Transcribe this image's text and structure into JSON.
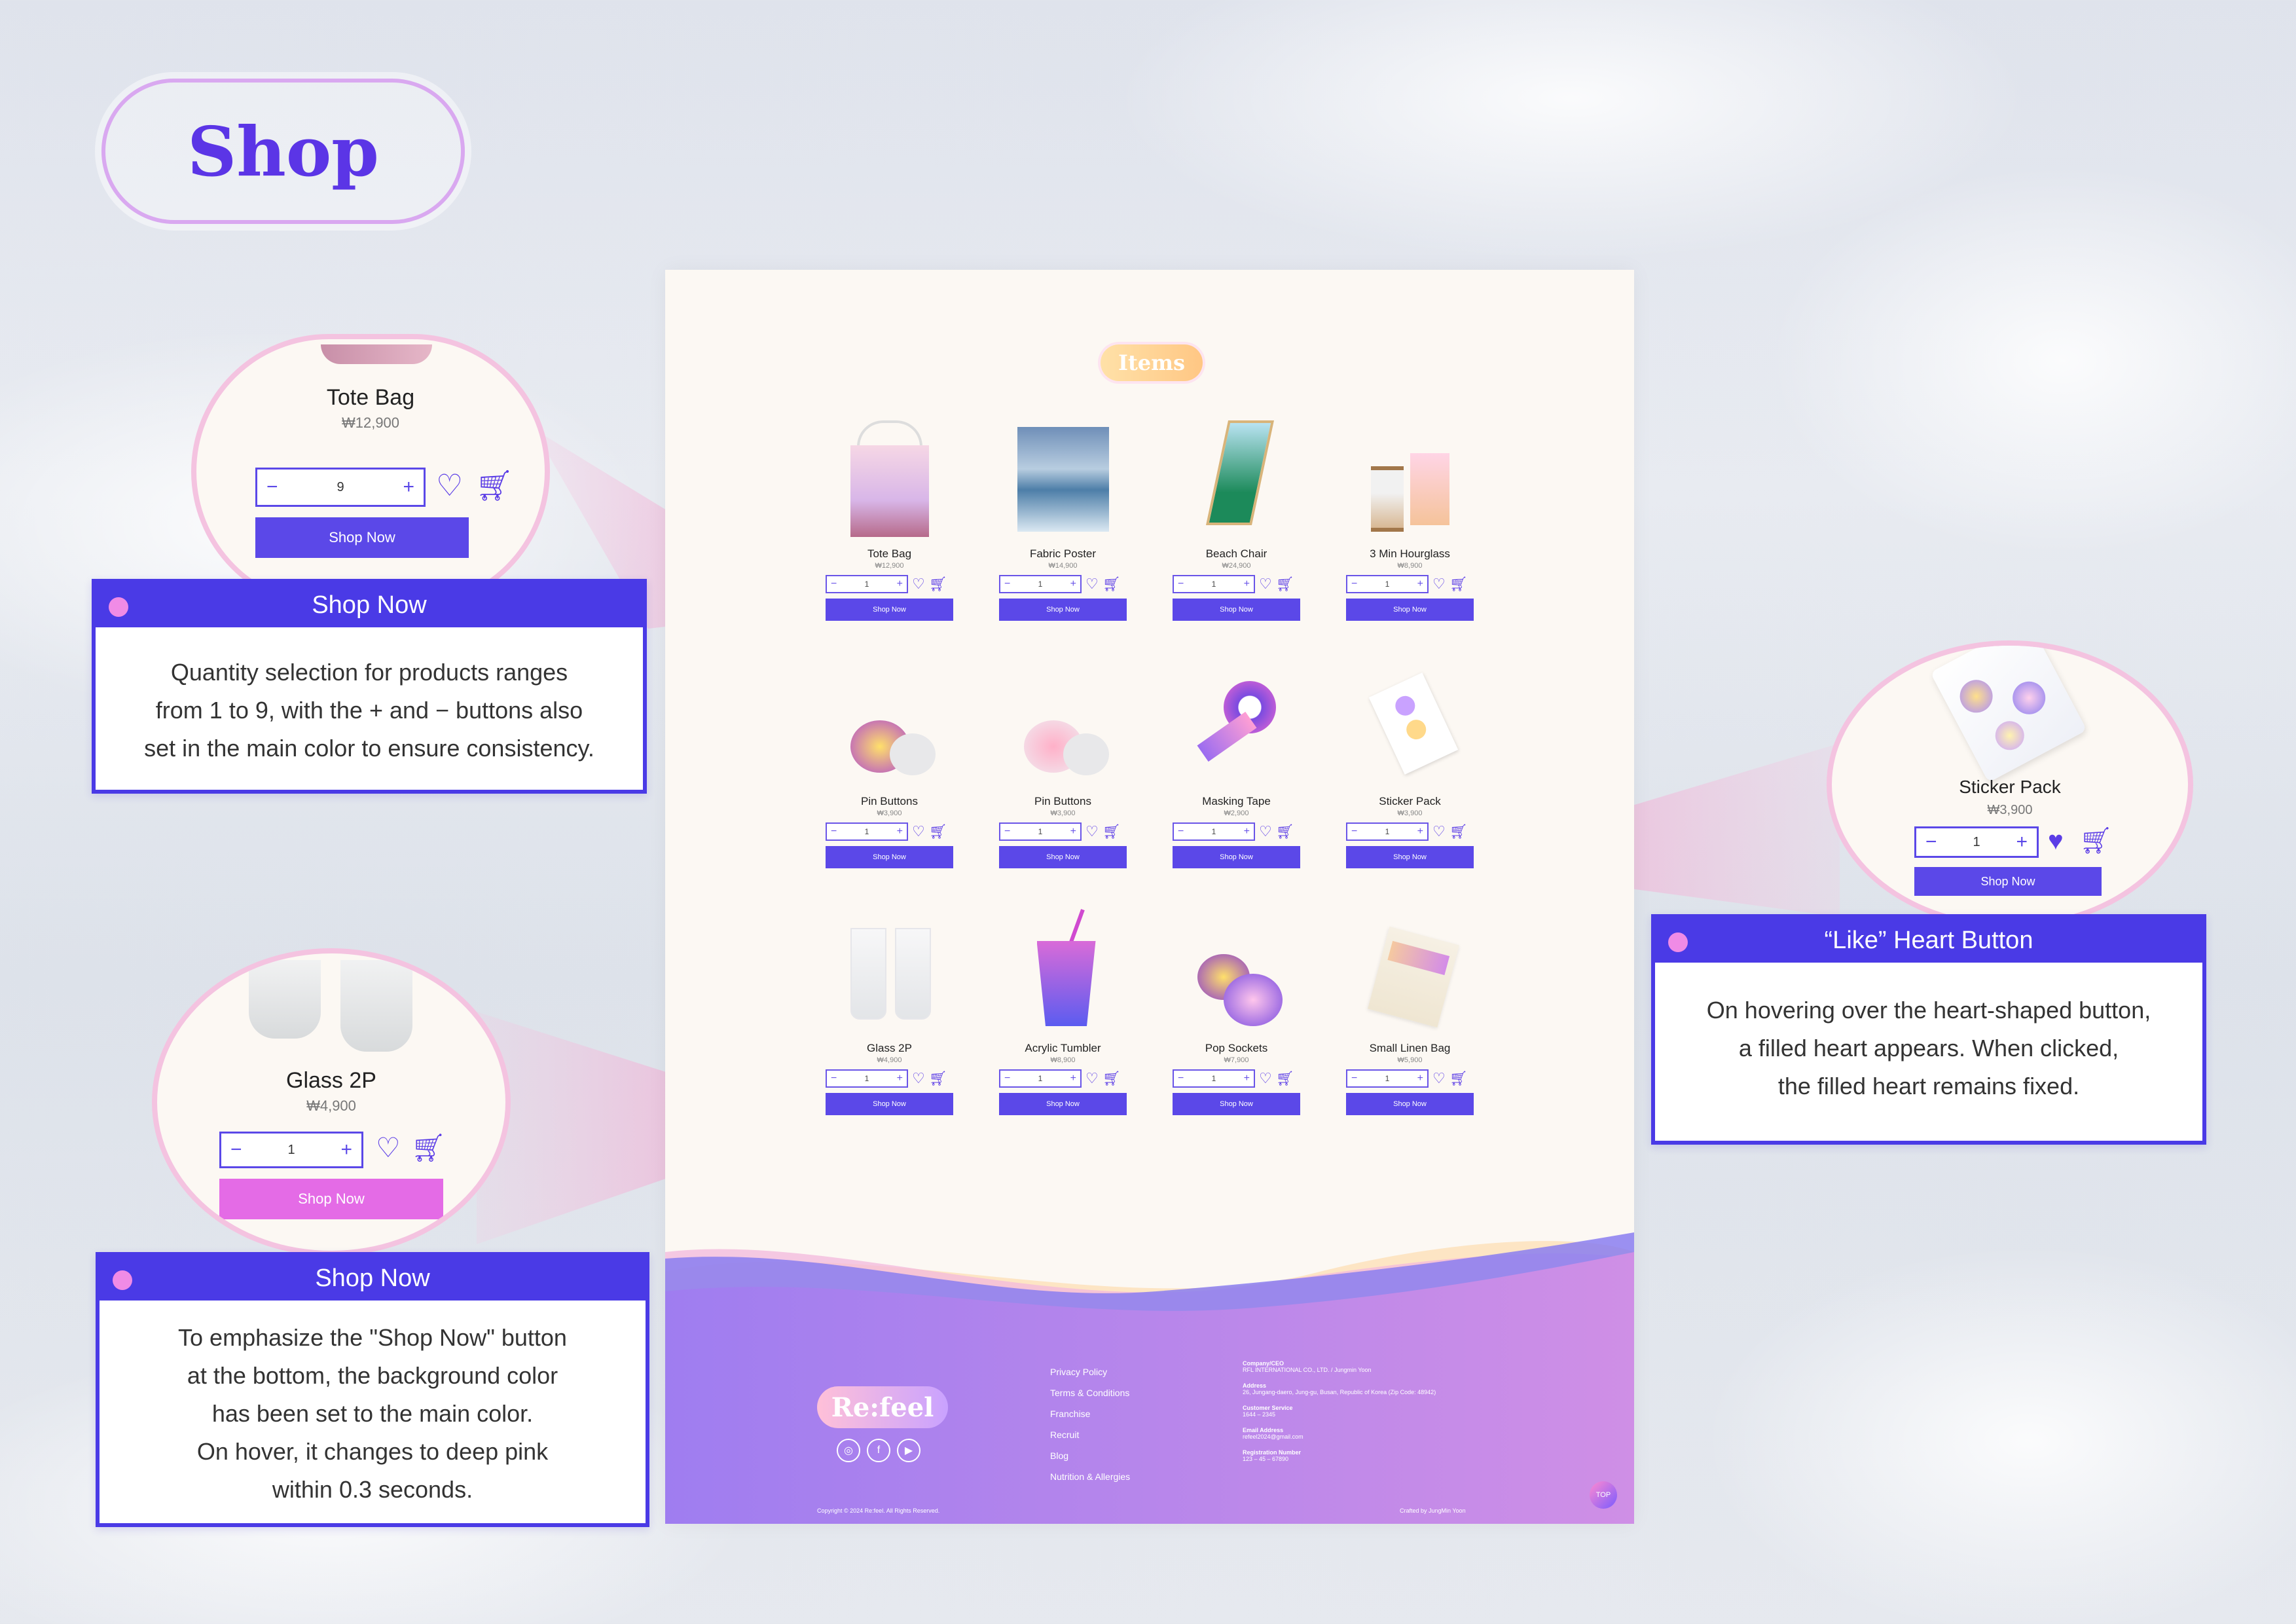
{
  "title": "Shop",
  "page": {
    "section_badge": "Items",
    "products": [
      {
        "name": "Tote Bag",
        "price": "₩12,900",
        "qty": "1",
        "img": "tote"
      },
      {
        "name": "Fabric Poster",
        "price": "₩14,900",
        "qty": "1",
        "img": "poster"
      },
      {
        "name": "Beach Chair",
        "price": "₩24,900",
        "qty": "1",
        "img": "chair"
      },
      {
        "name": "3 Min Hourglass",
        "price": "₩8,900",
        "qty": "1",
        "img": "hourglass"
      },
      {
        "name": "Pin Buttons",
        "price": "₩3,900",
        "qty": "1",
        "img": "pin1"
      },
      {
        "name": "Pin Buttons",
        "price": "₩3,900",
        "qty": "1",
        "img": "pin2"
      },
      {
        "name": "Masking Tape",
        "price": "₩2,900",
        "qty": "1",
        "img": "tape"
      },
      {
        "name": "Sticker Pack",
        "price": "₩3,900",
        "qty": "1",
        "img": "sticker"
      },
      {
        "name": "Glass 2P",
        "price": "₩4,900",
        "qty": "1",
        "img": "glass"
      },
      {
        "name": "Acrylic Tumbler",
        "price": "₩8,900",
        "qty": "1",
        "img": "tumbler"
      },
      {
        "name": "Pop Sockets",
        "price": "₩7,900",
        "qty": "1",
        "img": "popsocket"
      },
      {
        "name": "Small Linen Bag",
        "price": "₩5,900",
        "qty": "1",
        "img": "linenbag"
      }
    ],
    "button_label": "Shop Now",
    "minus": "−",
    "plus": "+",
    "footer": {
      "logo": "Re:feel",
      "links": [
        "Privacy Policy",
        "Terms & Conditions",
        "Franchise",
        "Recruit",
        "Blog",
        "Nutrition & Allergies"
      ],
      "info": [
        {
          "label": "Company/CEO",
          "value": "RFL INTERNATIONAL CO., LTD. / Jungmin Yoon"
        },
        {
          "label": "Address",
          "value": "26, Jungang-daero, Jung-gu, Busan, Republic of Korea (Zip Code: 48942)"
        },
        {
          "label": "Customer Service",
          "value": "1644 – 2345"
        },
        {
          "label": "Email Address",
          "value": "refeel2024@gmail.com"
        },
        {
          "label": "Registration Number",
          "value": "123 – 45 – 67890"
        }
      ],
      "copyright": "Copyright © 2024 Re:feel. All Rights Reserved.",
      "crafted": "Crafted by JungMin Yoon",
      "top": "TOP"
    }
  },
  "callouts": {
    "qty": {
      "product": "Tote Bag",
      "price": "₩12,900",
      "qty": "9",
      "button": "Shop Now",
      "title": "Shop Now",
      "lines": [
        "Quantity selection for products ranges",
        "from 1 to 9, with the + and − buttons also",
        "set in the main color to ensure consistency."
      ]
    },
    "shopnow": {
      "product": "Glass 2P",
      "price": "₩4,900",
      "qty": "1",
      "button": "Shop Now",
      "title": "Shop Now",
      "lines": [
        "To emphasize the \"Shop Now\" button",
        "at the bottom, the background color",
        "has been set to the main color.",
        "On hover, it changes to deep pink",
        "within 0.3 seconds."
      ]
    },
    "like": {
      "product": "Sticker Pack",
      "price": "₩3,900",
      "qty": "1",
      "button": "Shop Now",
      "title": "“Like” Heart Button",
      "lines": [
        "On hovering over the heart-shaped button,",
        "a filled heart appears. When clicked,",
        "the filled heart remains fixed."
      ]
    }
  },
  "colors": {
    "main": "#5b48e8",
    "deep_pink": "#e46be6",
    "border_pink": "#f4c3e0",
    "box_blue": "#4a3ae6"
  }
}
